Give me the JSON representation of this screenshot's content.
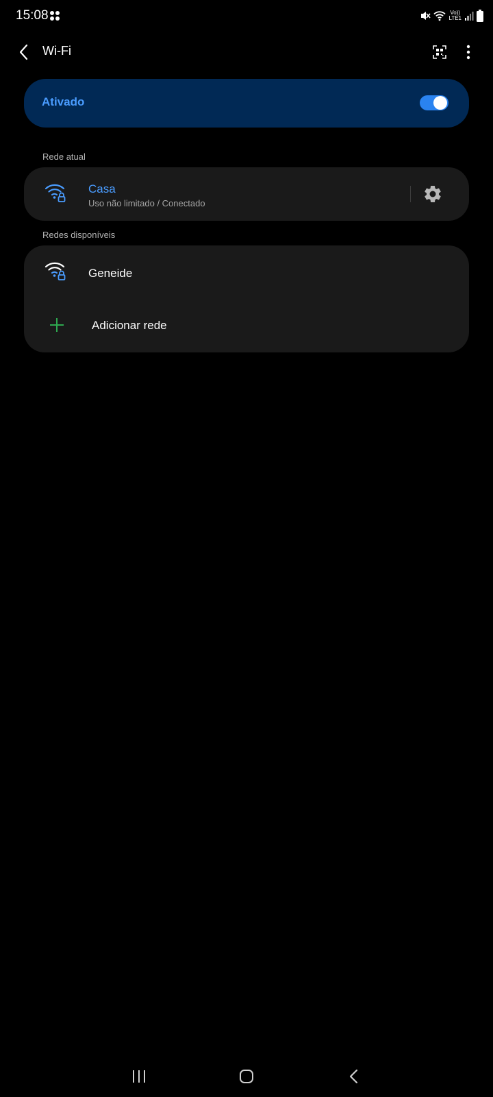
{
  "status_bar": {
    "time": "15:08",
    "volte_top": "Vo))",
    "volte_bottom": "LTE1"
  },
  "app_bar": {
    "title": "Wi-Fi"
  },
  "wifi_master": {
    "label": "Ativado",
    "enabled": true
  },
  "current_network": {
    "section_title": "Rede atual",
    "name": "Casa",
    "status": "Uso não limitado / Conectado"
  },
  "available_networks": {
    "section_title": "Redes disponíveis",
    "items": [
      {
        "name": "Geneide",
        "secured": true
      }
    ],
    "add_label": "Adicionar rede"
  },
  "colors": {
    "background": "#000000",
    "accent_blue": "#4a9cff",
    "master_card": "#012955",
    "card": "#1a1a1a",
    "add_green": "#2ea84f"
  },
  "icons": {
    "status_left": "app-dots-icon",
    "status_right": [
      "mute-icon",
      "wifi-signal-icon",
      "volte-icon",
      "cell-signal-icon",
      "battery-icon"
    ],
    "app_bar": [
      "back-icon",
      "qr-code-icon",
      "more-vert-icon"
    ],
    "rows": [
      "wifi-lock-icon",
      "gear-icon",
      "plus-icon"
    ],
    "nav": [
      "recents-icon",
      "home-icon",
      "back-nav-icon"
    ]
  }
}
